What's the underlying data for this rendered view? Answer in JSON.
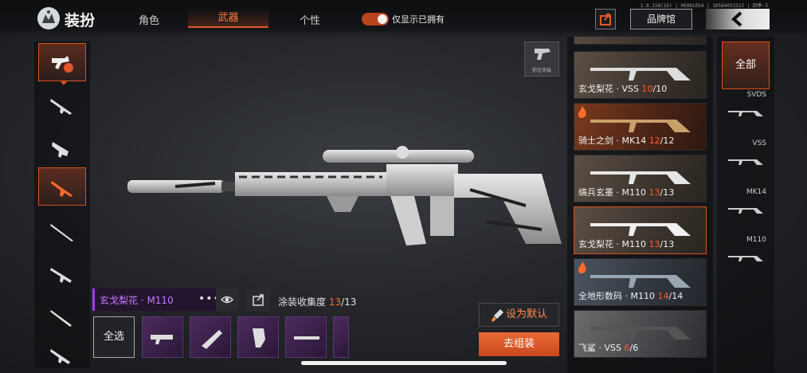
{
  "header": {
    "title": "装扮",
    "tabs": [
      "角色",
      "武器",
      "个性"
    ],
    "active_tab": "武器",
    "toggle_label": "仅显示已拥有",
    "toggle_on": true,
    "version": "1.0.158(16) | 06081054 | 10584053323 | 四季-5",
    "brand_button": "品牌馆"
  },
  "preview": {
    "apply_paint_label": "前往涂装",
    "skin_name": "玄戈梨花 · M110",
    "collection_label": "涂装收集度",
    "collection_owned": "13",
    "collection_total": "/13",
    "select_all": "全选",
    "set_default": "设为默认",
    "go_assemble": "去组装"
  },
  "skins": [
    {
      "name": "玄戈梨花 · VSS ",
      "owned": "10",
      "total": "/10",
      "flame": false
    },
    {
      "name": "骑士之剑 · MK14 ",
      "owned": "12",
      "total": "/12",
      "flame": true
    },
    {
      "name": "缟兵玄墨 · M110 ",
      "owned": "13",
      "total": "/13",
      "flame": false
    },
    {
      "name": "玄戈梨花 · M110 ",
      "owned": "13",
      "total": "/13",
      "flame": false
    },
    {
      "name": "全地形数码 · M110 ",
      "owned": "14",
      "total": "/14",
      "flame": true
    },
    {
      "name": "飞鲨 · VSS ",
      "owned": "6",
      "total": "/6",
      "flame": false
    }
  ],
  "weapon_types": {
    "all": "全部",
    "items": [
      "SVDS",
      "VSS",
      "MK14",
      "M110"
    ]
  },
  "colors": {
    "accent": "#e0562b",
    "purple": "#a33cf0"
  }
}
